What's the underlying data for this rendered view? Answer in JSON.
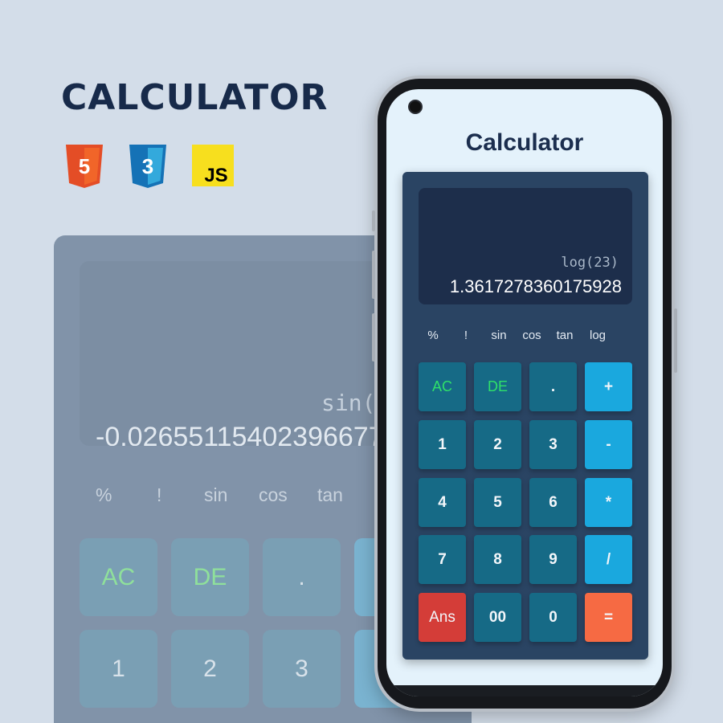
{
  "page": {
    "heading": "CALCULATOR",
    "tech_icons": [
      {
        "icon": "html5-icon",
        "label": "5",
        "color": "#e44d26"
      },
      {
        "icon": "css3-icon",
        "label": "3",
        "color": "#1572b6"
      },
      {
        "icon": "js-icon",
        "label": "JS",
        "color": "#f7df1e"
      }
    ]
  },
  "background_calculator": {
    "expression": "sin(6",
    "result": "-0.02655115402396677",
    "scientific": [
      "%",
      "!",
      "sin",
      "cos",
      "tan"
    ],
    "keys": [
      "AC",
      "DE",
      ".",
      "1",
      "2",
      "3"
    ]
  },
  "phone": {
    "title": "Calculator",
    "display": {
      "expression": "log(23)",
      "result": "1.3617278360175928"
    },
    "scientific": [
      "%",
      "!",
      "sin",
      "cos",
      "tan",
      "log"
    ],
    "keys": [
      [
        "AC",
        "DE",
        ".",
        "+"
      ],
      [
        "1",
        "2",
        "3",
        "-"
      ],
      [
        "4",
        "5",
        "6",
        "*"
      ],
      [
        "7",
        "8",
        "9",
        "/"
      ],
      [
        "Ans",
        "00",
        "0",
        "="
      ]
    ],
    "colors": {
      "number_key": "#166a86",
      "operator_key": "#1aa8de",
      "ans_key": "#d43d38",
      "equals_key": "#f66a43",
      "clear_text": "#2fe06a"
    }
  }
}
